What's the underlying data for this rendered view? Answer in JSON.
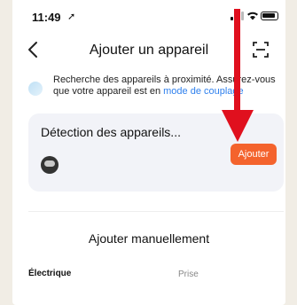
{
  "status_bar": {
    "time": "11:49",
    "location_icon": "location-arrow-icon",
    "signal_icon": "signal-icon",
    "wifi_icon": "wifi-icon",
    "battery_icon": "battery-icon"
  },
  "header": {
    "title": "Ajouter un appareil",
    "back_icon": "chevron-left-icon",
    "scan_icon": "scan-icon"
  },
  "info": {
    "text": "Recherche des appareils à proximité. Assurez-vous que votre appareil est en ",
    "link": "mode de couplage",
    "icon": "bluetooth-icon"
  },
  "detection": {
    "heading": "Détection des appareils...",
    "add_button": "Ajouter",
    "device_icon": "device-icon"
  },
  "manual": {
    "heading": "Ajouter manuellement",
    "category": "Électrique",
    "items": [
      "Prise"
    ]
  },
  "colors": {
    "accent": "#f4632d",
    "link": "#2f80ed",
    "annotation": "#e0101e"
  }
}
